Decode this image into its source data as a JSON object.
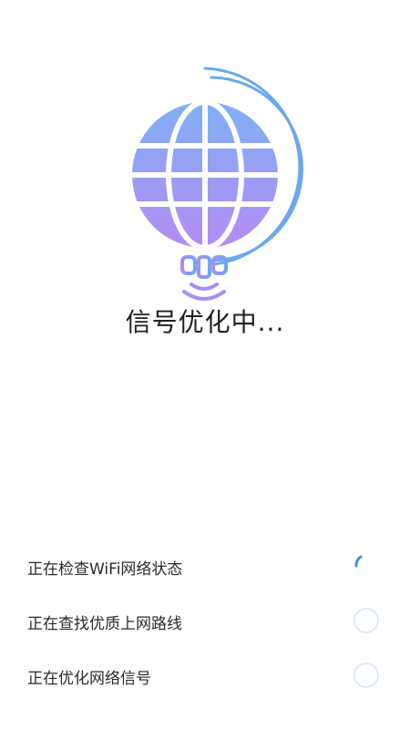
{
  "status": {
    "title": "信号优化中..."
  },
  "tasks": [
    {
      "label": "正在检查WiFi网络状态",
      "state": "in-progress"
    },
    {
      "label": "正在查找优质上网路线",
      "state": "pending"
    },
    {
      "label": "正在优化网络信号",
      "state": "pending"
    }
  ],
  "colors": {
    "globe_top": "#7fb0f5",
    "globe_bottom": "#b48cf3",
    "arc": "#6aa8ef",
    "satellite": "#7a9cf4",
    "spinner": "#4a90e2",
    "pending_circle": "#dbe9fb",
    "text": "#222222"
  },
  "icons": {
    "hero": "globe-satellite-illustration",
    "in_progress": "loading-spinner-icon",
    "pending": "pending-circle-icon"
  }
}
